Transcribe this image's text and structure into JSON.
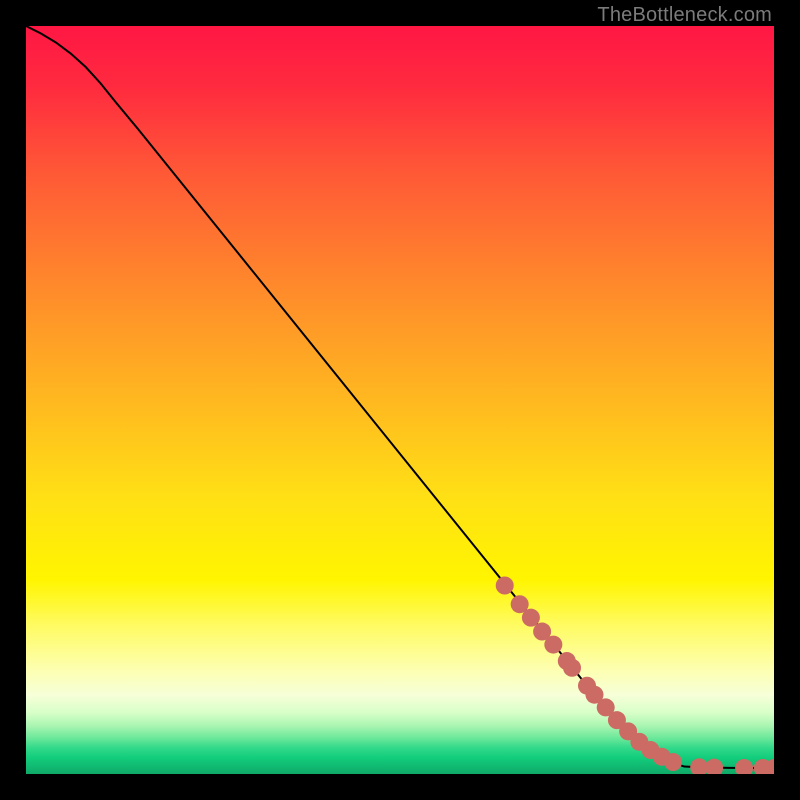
{
  "watermark": "TheBottleneck.com",
  "chart_data": {
    "type": "line",
    "title": "",
    "xlabel": "",
    "ylabel": "",
    "xlim": [
      0,
      100
    ],
    "ylim": [
      0,
      100
    ],
    "grid": false,
    "legend": false,
    "gradient_stops": [
      {
        "offset": 0.0,
        "color": "#ff1744"
      },
      {
        "offset": 0.08,
        "color": "#ff2a3f"
      },
      {
        "offset": 0.2,
        "color": "#ff5a36"
      },
      {
        "offset": 0.35,
        "color": "#ff8a2b"
      },
      {
        "offset": 0.5,
        "color": "#ffb820"
      },
      {
        "offset": 0.63,
        "color": "#ffe015"
      },
      {
        "offset": 0.74,
        "color": "#fff500"
      },
      {
        "offset": 0.8,
        "color": "#fffb60"
      },
      {
        "offset": 0.86,
        "color": "#fdffb0"
      },
      {
        "offset": 0.895,
        "color": "#f6ffd8"
      },
      {
        "offset": 0.918,
        "color": "#d8ffc8"
      },
      {
        "offset": 0.936,
        "color": "#a8f5b0"
      },
      {
        "offset": 0.952,
        "color": "#6be89a"
      },
      {
        "offset": 0.965,
        "color": "#32d98a"
      },
      {
        "offset": 0.978,
        "color": "#12cd7c"
      },
      {
        "offset": 1.0,
        "color": "#0fa968"
      }
    ],
    "series": [
      {
        "name": "curve",
        "color": "#000000",
        "width": 2,
        "x": [
          0,
          2,
          4,
          6,
          8,
          10,
          12,
          15,
          20,
          25,
          30,
          35,
          40,
          45,
          50,
          55,
          60,
          65,
          70,
          75,
          80,
          85,
          88,
          90,
          92,
          94,
          96,
          98,
          100
        ],
        "y": [
          100,
          99.0,
          97.8,
          96.3,
          94.5,
          92.3,
          89.8,
          86.2,
          80.0,
          73.8,
          67.6,
          61.4,
          55.2,
          49.0,
          42.8,
          36.6,
          30.4,
          24.2,
          18.0,
          11.8,
          6.0,
          2.0,
          1.0,
          0.9,
          0.85,
          0.82,
          0.8,
          0.8,
          0.8
        ]
      }
    ],
    "markers": {
      "name": "points",
      "color": "#cc6b63",
      "radius": 9,
      "x": [
        64,
        66,
        67.5,
        69,
        70.5,
        72.3,
        73,
        75,
        76,
        77.5,
        79,
        80.5,
        82,
        83.5,
        85,
        86.5,
        90,
        92,
        96,
        98.5,
        100
      ],
      "y": [
        25.2,
        22.7,
        20.9,
        19.05,
        17.3,
        15.1,
        14.2,
        11.8,
        10.6,
        8.9,
        7.2,
        5.7,
        4.3,
        3.2,
        2.3,
        1.6,
        0.9,
        0.85,
        0.8,
        0.8,
        0.8
      ]
    }
  }
}
